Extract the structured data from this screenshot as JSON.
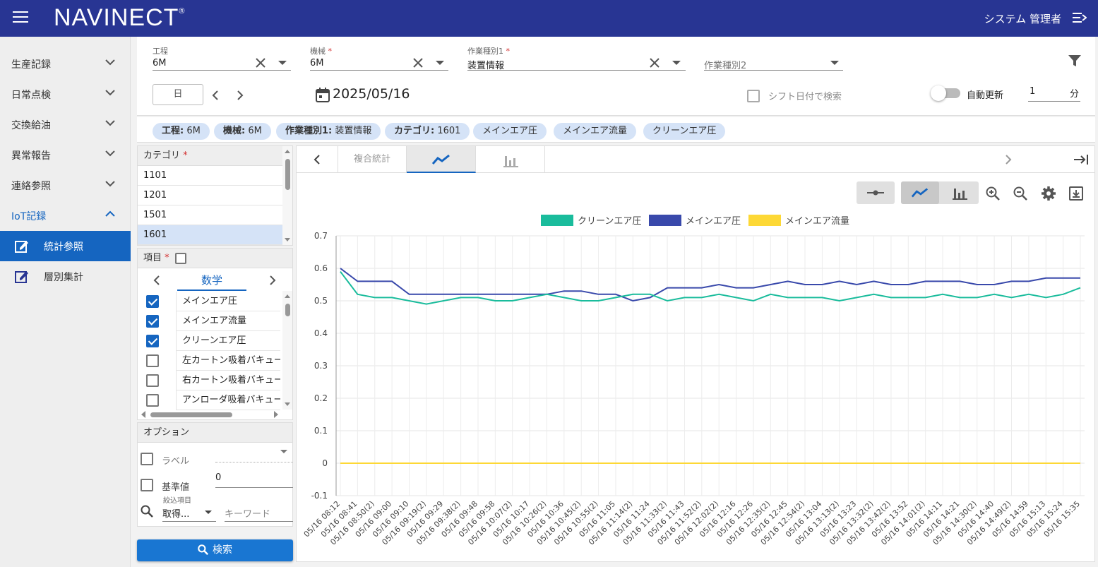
{
  "app": {
    "logo": "NAVINECT",
    "logo_mark": "®",
    "user": "システム 管理者"
  },
  "sidebar": {
    "items": [
      {
        "label": "生産記録"
      },
      {
        "label": "日常点検"
      },
      {
        "label": "交換給油"
      },
      {
        "label": "異常報告"
      },
      {
        "label": "連絡参照"
      },
      {
        "label": "IoT記録"
      }
    ],
    "sub_items": [
      {
        "label": "統計参照"
      },
      {
        "label": "層別集計"
      }
    ]
  },
  "filters": {
    "process": {
      "label": "工程",
      "value": "6M"
    },
    "machine": {
      "label": "機械",
      "required": "*",
      "value": "6M"
    },
    "work_type1": {
      "label": "作業種別1",
      "required": "*",
      "value": "装置情報"
    },
    "work_type2": {
      "placeholder": "作業種別2"
    },
    "period_button": "日",
    "date": "2025/05/16",
    "shift_search": "シフト日付で検索",
    "auto_refresh": "自動更新",
    "interval_value": "1",
    "interval_unit": "分"
  },
  "chips": [
    {
      "key": "工程:",
      "value": " 6M"
    },
    {
      "key": "機械:",
      "value": " 6M"
    },
    {
      "key": "作業種別1:",
      "value": " 装置情報"
    },
    {
      "key": "カテゴリ:",
      "value": " 1601"
    },
    {
      "key": "",
      "value": "メインエア圧"
    },
    {
      "key": "",
      "value": "メインエア流量"
    },
    {
      "key": "",
      "value": "クリーンエア圧"
    }
  ],
  "category_panel": {
    "title": "カテゴリ",
    "required": "*",
    "rows": [
      "1101",
      "1201",
      "1501",
      "1601"
    ],
    "selected": "1601"
  },
  "item_panel": {
    "title": "項目",
    "required": "*",
    "tab_label": "数学",
    "rows": [
      {
        "label": "メインエア圧",
        "checked": true
      },
      {
        "label": "メインエア流量",
        "checked": true
      },
      {
        "label": "クリーンエア圧",
        "checked": true
      },
      {
        "label": "左カートン吸着バキューム",
        "checked": false
      },
      {
        "label": "右カートン吸着バキューム",
        "checked": false
      },
      {
        "label": "アンローダ吸着バキューム",
        "checked": false
      }
    ]
  },
  "options_panel": {
    "title": "オプション",
    "label_option": "ラベル",
    "baseline_option": "基準値",
    "baseline_value": "0",
    "filter_label": "絞込項目",
    "filter_select": "取得...",
    "keyword_placeholder": "キーワード"
  },
  "search_button": "検索",
  "chart_tabs": [
    {
      "label": "複合統計"
    },
    {
      "label": "",
      "icon": "line-chart-icon",
      "active": true
    },
    {
      "label": "",
      "icon": "bar-chart-icon"
    }
  ],
  "colors": {
    "header": "#283593",
    "accent": "#1565c0",
    "clean_air": "#1abc9c",
    "main_air": "#3949ab",
    "main_flow": "#fdd835"
  },
  "chart_data": {
    "type": "line",
    "ylim": [
      -0.1,
      0.7
    ],
    "yticks": [
      "0.7",
      "0.6",
      "0.5",
      "0.4",
      "0.3",
      "0.2",
      "0.1",
      "0",
      "-0.1"
    ],
    "grid": true,
    "legend_position": "top-center",
    "x_tick_labels": [
      "05/16 08:12",
      "05/16 08:41",
      "05/16 08:50(2)",
      "05/16 09:00",
      "05/16 09:10",
      "05/16 09:19(2)",
      "05/16 09:29",
      "05/16 09:38(2)",
      "05/16 09:48",
      "05/16 09:58",
      "05/16 10:07(2)",
      "05/16 10:17",
      "05/16 10:26(2)",
      "05/16 10:36",
      "05/16 10:45(2)",
      "05/16 10:55(2)",
      "05/16 11:05",
      "05/16 11:14(2)",
      "05/16 11:24",
      "05/16 11:33(2)",
      "05/16 11:43",
      "05/16 11:52(2)",
      "05/16 12:02(2)",
      "05/16 12:16",
      "05/16 12:26",
      "05/16 12:35(2)",
      "05/16 12:45",
      "05/16 12:54(2)",
      "05/16 13:04",
      "05/16 13:13(2)",
      "05/16 13:23",
      "05/16 13:32(2)",
      "05/16 13:42(2)",
      "05/16 13:52",
      "05/16 14:01(2)",
      "05/16 14:11",
      "05/16 14:21",
      "05/16 14:30(2)",
      "05/16 14:40",
      "05/16 14:49(2)",
      "05/16 14:59",
      "05/16 15:13",
      "05/16 15:24",
      "05/16 15:35"
    ],
    "series": [
      {
        "name": "クリーンエア圧",
        "color": "#1abc9c",
        "values": [
          0.59,
          0.52,
          0.51,
          0.51,
          0.5,
          0.49,
          0.5,
          0.51,
          0.51,
          0.5,
          0.5,
          0.51,
          0.52,
          0.51,
          0.5,
          0.5,
          0.51,
          0.52,
          0.52,
          0.5,
          0.51,
          0.51,
          0.52,
          0.51,
          0.5,
          0.52,
          0.51,
          0.51,
          0.51,
          0.5,
          0.51,
          0.52,
          0.51,
          0.51,
          0.51,
          0.52,
          0.51,
          0.51,
          0.52,
          0.51,
          0.52,
          0.51,
          0.52,
          0.54
        ]
      },
      {
        "name": "メインエア圧",
        "color": "#3949ab",
        "values": [
          0.6,
          0.56,
          0.56,
          0.56,
          0.52,
          0.52,
          0.52,
          0.52,
          0.52,
          0.52,
          0.52,
          0.52,
          0.52,
          0.53,
          0.53,
          0.52,
          0.52,
          0.5,
          0.51,
          0.54,
          0.54,
          0.54,
          0.55,
          0.54,
          0.54,
          0.55,
          0.56,
          0.55,
          0.55,
          0.56,
          0.55,
          0.56,
          0.55,
          0.55,
          0.56,
          0.56,
          0.56,
          0.55,
          0.55,
          0.56,
          0.56,
          0.57,
          0.57,
          0.57
        ]
      },
      {
        "name": "メインエア流量",
        "color": "#fdd835",
        "values": [
          0,
          0,
          0,
          0,
          0,
          0,
          0,
          0,
          0,
          0,
          0,
          0,
          0,
          0,
          0,
          0,
          0,
          0,
          0,
          0,
          0,
          0,
          0,
          0,
          0,
          0,
          0,
          0,
          0,
          0,
          0,
          0,
          0,
          0,
          0,
          0,
          0,
          0,
          0,
          0,
          0,
          0,
          0,
          0
        ]
      }
    ]
  }
}
